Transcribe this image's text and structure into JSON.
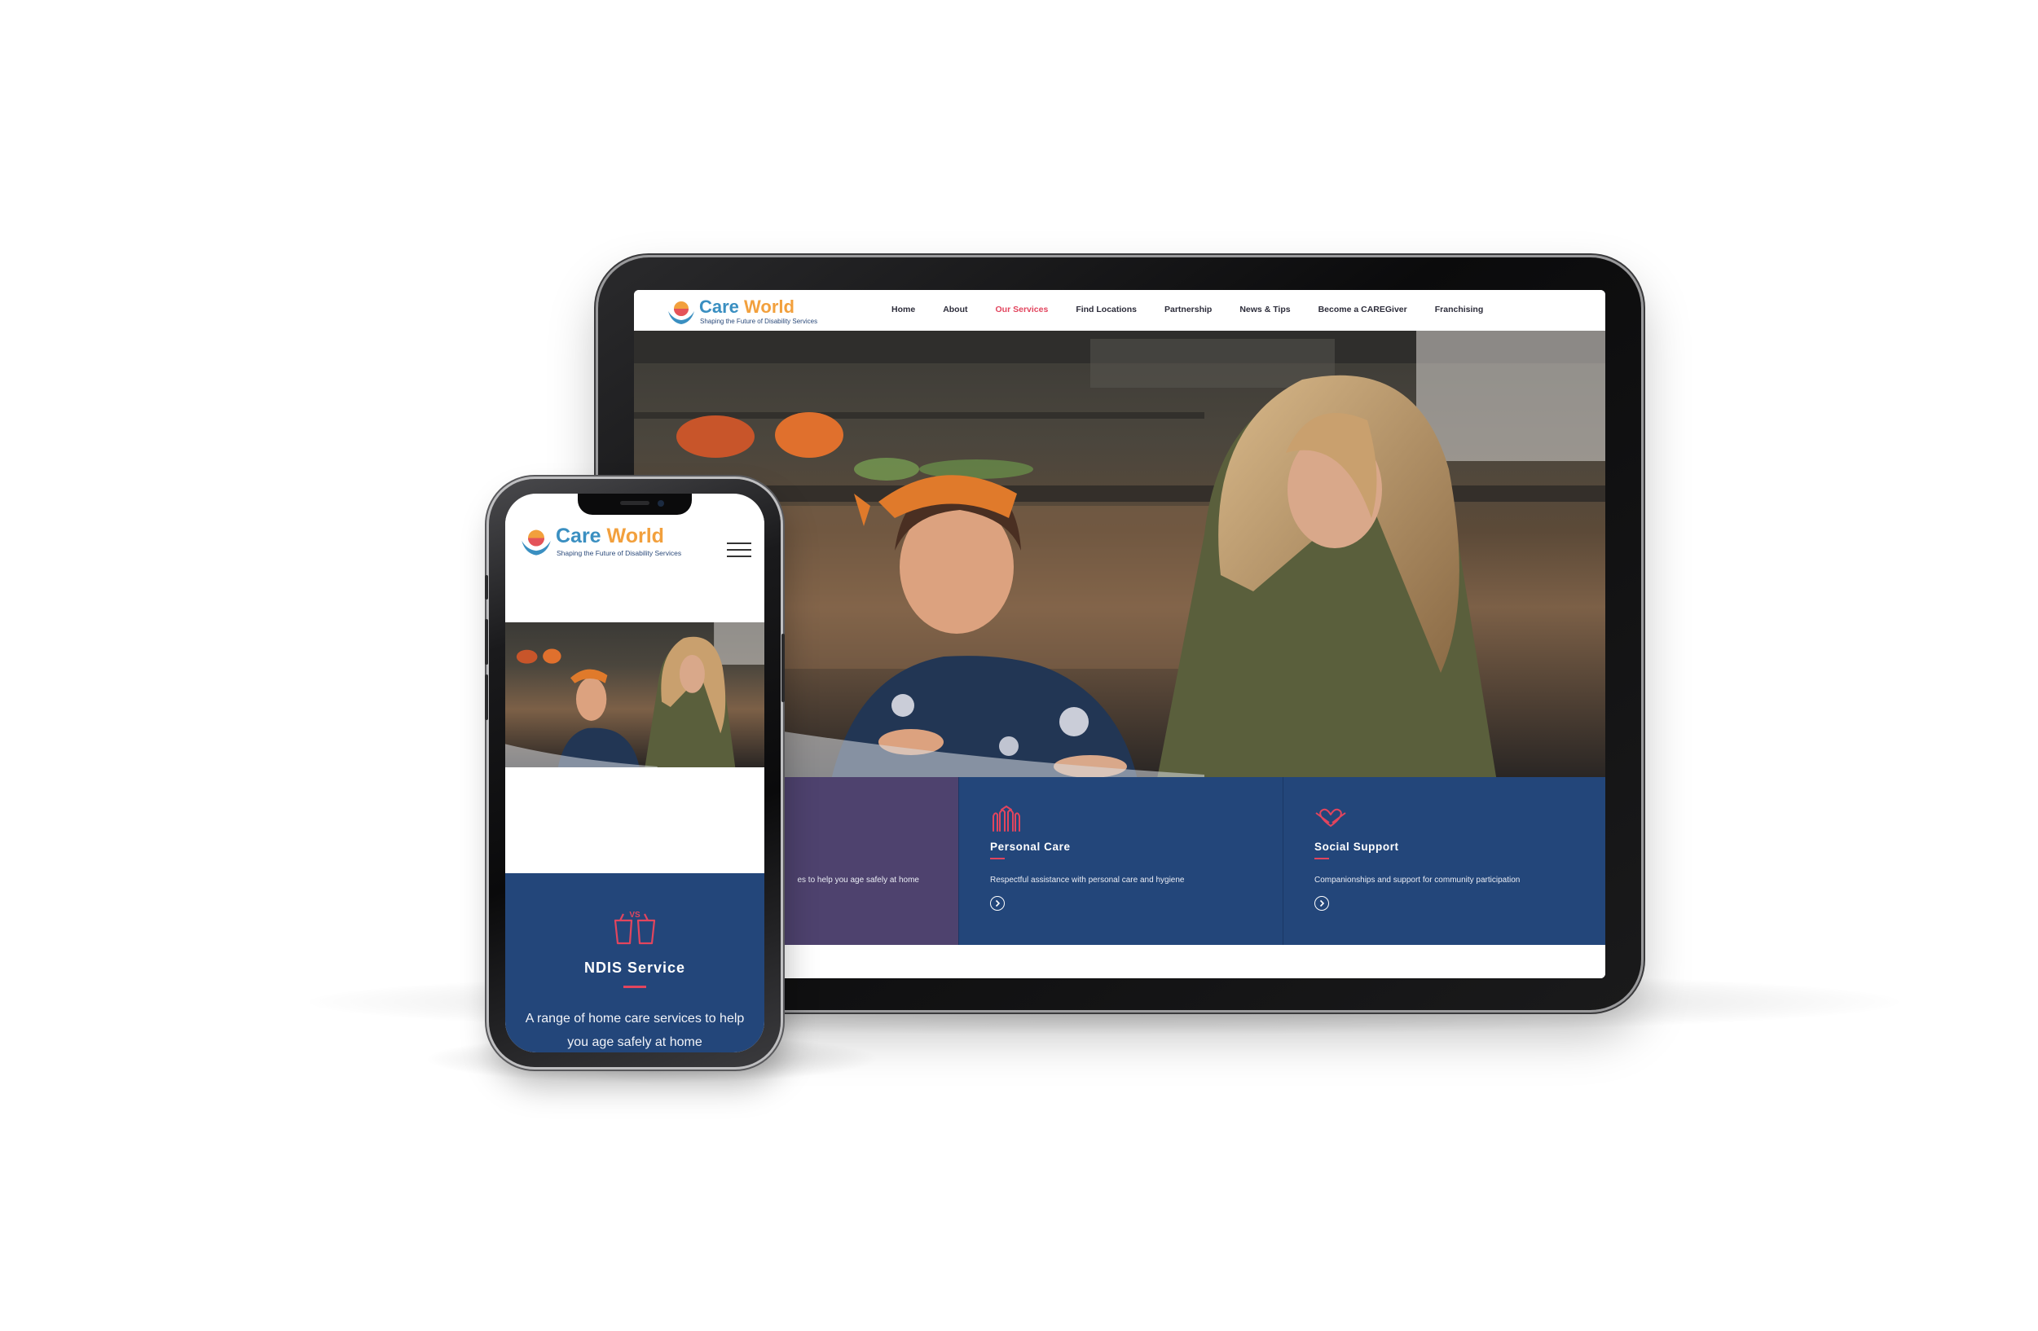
{
  "brand": {
    "name_part1": "Care",
    "name_part2": "World",
    "tagline": "Shaping the Future of Disability Services",
    "colors": {
      "blue": "#3a8fc1",
      "orange": "#f2a03d",
      "navy": "#23467a",
      "purple": "#4e426e",
      "accent": "#e2455e"
    }
  },
  "tablet": {
    "nav": [
      {
        "label": "Home",
        "active": false
      },
      {
        "label": "About",
        "active": false
      },
      {
        "label": "Our Services",
        "active": true
      },
      {
        "label": "Find Locations",
        "active": false
      },
      {
        "label": "Partnership",
        "active": false
      },
      {
        "label": "News & Tips",
        "active": false
      },
      {
        "label": "Become a CAREGiver",
        "active": false
      },
      {
        "label": "Franchising",
        "active": false
      }
    ],
    "cards": [
      {
        "title": "",
        "desc": "es to help you age safely at home",
        "icon": ""
      },
      {
        "title": "Personal Care",
        "desc": "Respectful assistance with personal care and hygiene",
        "icon": "raised-hands-icon"
      },
      {
        "title": "Social Support",
        "desc": "Companionships and support for community participation",
        "icon": "handshake-heart-icon"
      }
    ]
  },
  "phone": {
    "card": {
      "title": "NDIS Service",
      "desc": "A range of home care services to help you age safely at home",
      "icon": "ndis-icon"
    }
  }
}
